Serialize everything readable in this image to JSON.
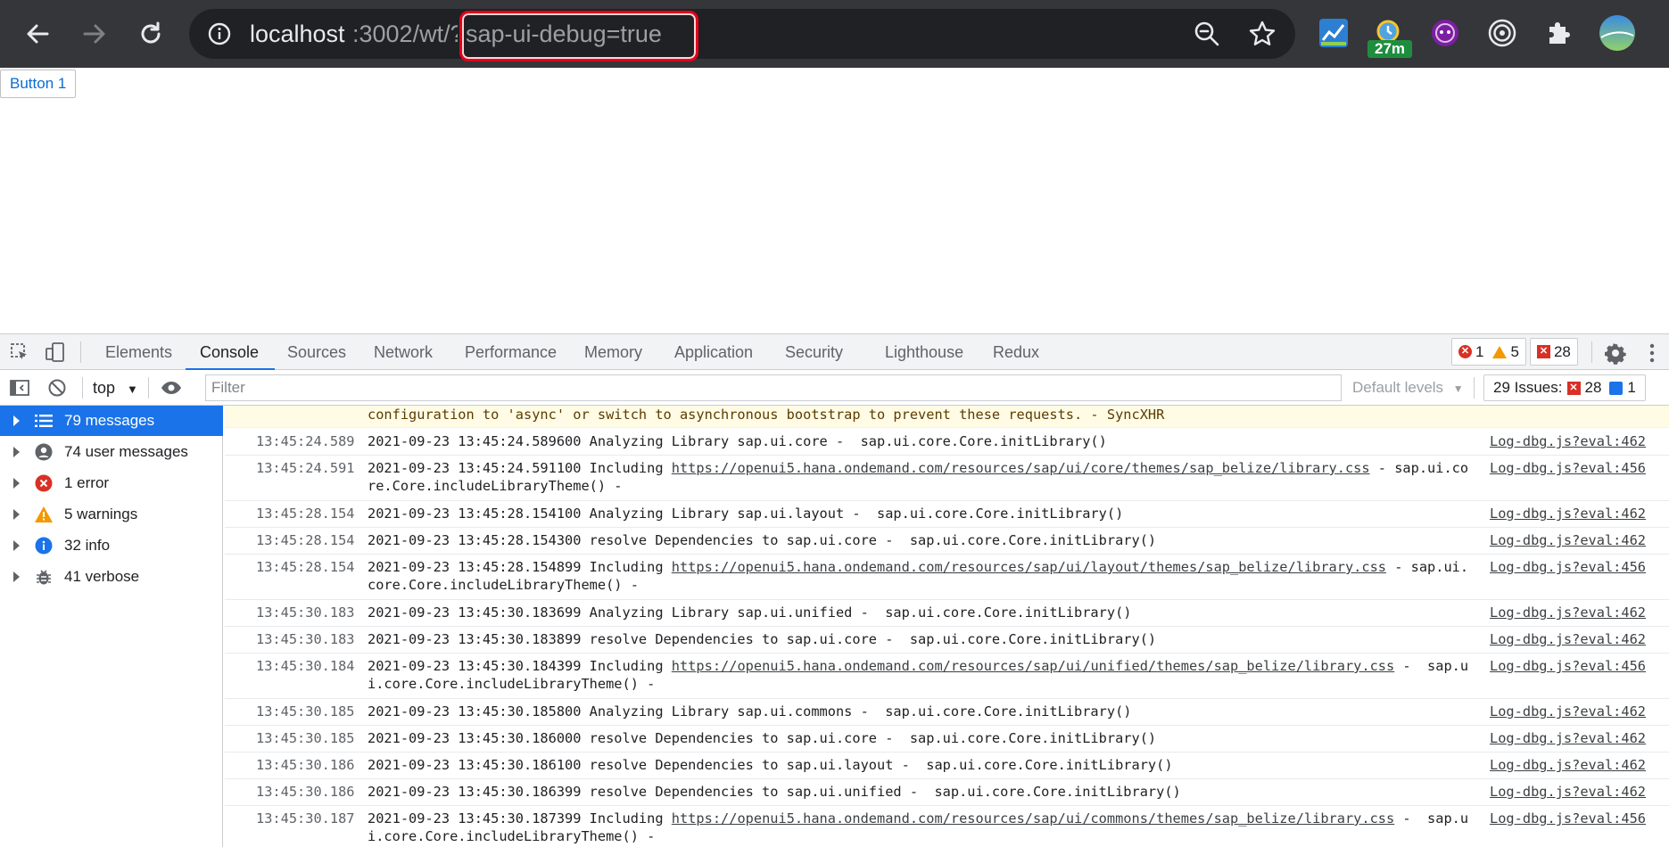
{
  "browser": {
    "url_host": "localhost",
    "url_path": ":3002/wt/?",
    "url_query": "sap-ui-debug=true",
    "extension_badge": "27m"
  },
  "page": {
    "button1_label": "Button 1"
  },
  "devtools": {
    "tabs": [
      "Elements",
      "Console",
      "Sources",
      "Network",
      "Performance",
      "Memory",
      "Application",
      "Security",
      "Lighthouse",
      "Redux"
    ],
    "active_tab": "Console",
    "counts": {
      "errors": "1",
      "warnings": "5",
      "issues": "28"
    },
    "context": "top",
    "filter_placeholder": "Filter",
    "levels_label": "Default levels",
    "issues_label": "29 Issues:",
    "issues_errors": "28",
    "issues_info": "1",
    "sidebar": [
      {
        "label": "79 messages",
        "icon": "list-icon"
      },
      {
        "label": "74 user messages",
        "icon": "user-icon"
      },
      {
        "label": "1 error",
        "icon": "error-icon"
      },
      {
        "label": "5 warnings",
        "icon": "warning-icon"
      },
      {
        "label": "32 info",
        "icon": "info-icon"
      },
      {
        "label": "41 verbose",
        "icon": "bug-icon"
      }
    ],
    "warning_tail": "configuration to 'async' or switch to asynchronous bootstrap to prevent these requests. - SyncXHR",
    "messages": [
      {
        "time": "13:45:24.589",
        "text": "2021-09-23 13:45:24.589600 Analyzing Library sap.ui.core -  sap.ui.core.Core.initLibrary()",
        "source": "Log-dbg.js?eval:462"
      },
      {
        "time": "13:45:24.591",
        "pre": "2021-09-23 13:45:24.591100 Including ",
        "link": "https://openui5.hana.ondemand.com/resources/sap/ui/core/themes/sap_belize/library.css",
        "post": " - sap.ui.core.Core.includeLibraryTheme() -",
        "source": "Log-dbg.js?eval:456"
      },
      {
        "time": "13:45:28.154",
        "text": "2021-09-23 13:45:28.154100 Analyzing Library sap.ui.layout -  sap.ui.core.Core.initLibrary()",
        "source": "Log-dbg.js?eval:462"
      },
      {
        "time": "13:45:28.154",
        "text": "2021-09-23 13:45:28.154300 resolve Dependencies to sap.ui.core -  sap.ui.core.Core.initLibrary()",
        "source": "Log-dbg.js?eval:462"
      },
      {
        "time": "13:45:28.154",
        "pre": "2021-09-23 13:45:28.154899 Including ",
        "link": "https://openui5.hana.ondemand.com/resources/sap/ui/layout/themes/sap_belize/library.css",
        "post": " - sap.ui.core.Core.includeLibraryTheme() -",
        "source": "Log-dbg.js?eval:456"
      },
      {
        "time": "13:45:30.183",
        "text": "2021-09-23 13:45:30.183699 Analyzing Library sap.ui.unified -  sap.ui.core.Core.initLibrary()",
        "source": "Log-dbg.js?eval:462"
      },
      {
        "time": "13:45:30.183",
        "text": "2021-09-23 13:45:30.183899 resolve Dependencies to sap.ui.core -  sap.ui.core.Core.initLibrary()",
        "source": "Log-dbg.js?eval:462"
      },
      {
        "time": "13:45:30.184",
        "pre": "2021-09-23 13:45:30.184399 Including ",
        "link": "https://openui5.hana.ondemand.com/resources/sap/ui/unified/themes/sap_belize/library.css",
        "post": " -  sap.ui.core.Core.includeLibraryTheme() -",
        "source": "Log-dbg.js?eval:456"
      },
      {
        "time": "13:45:30.185",
        "text": "2021-09-23 13:45:30.185800 Analyzing Library sap.ui.commons -  sap.ui.core.Core.initLibrary()",
        "source": "Log-dbg.js?eval:462"
      },
      {
        "time": "13:45:30.185",
        "text": "2021-09-23 13:45:30.186000 resolve Dependencies to sap.ui.core -  sap.ui.core.Core.initLibrary()",
        "source": "Log-dbg.js?eval:462"
      },
      {
        "time": "13:45:30.186",
        "text": "2021-09-23 13:45:30.186100 resolve Dependencies to sap.ui.layout -  sap.ui.core.Core.initLibrary()",
        "source": "Log-dbg.js?eval:462"
      },
      {
        "time": "13:45:30.186",
        "text": "2021-09-23 13:45:30.186399 resolve Dependencies to sap.ui.unified -  sap.ui.core.Core.initLibrary()",
        "source": "Log-dbg.js?eval:462"
      },
      {
        "time": "13:45:30.187",
        "pre": "2021-09-23 13:45:30.187399 Including ",
        "link": "https://openui5.hana.ondemand.com/resources/sap/ui/commons/themes/sap_belize/library.css",
        "post": " -  sap.ui.core.Core.includeLibraryTheme() -",
        "source": "Log-dbg.js?eval:456"
      }
    ]
  }
}
